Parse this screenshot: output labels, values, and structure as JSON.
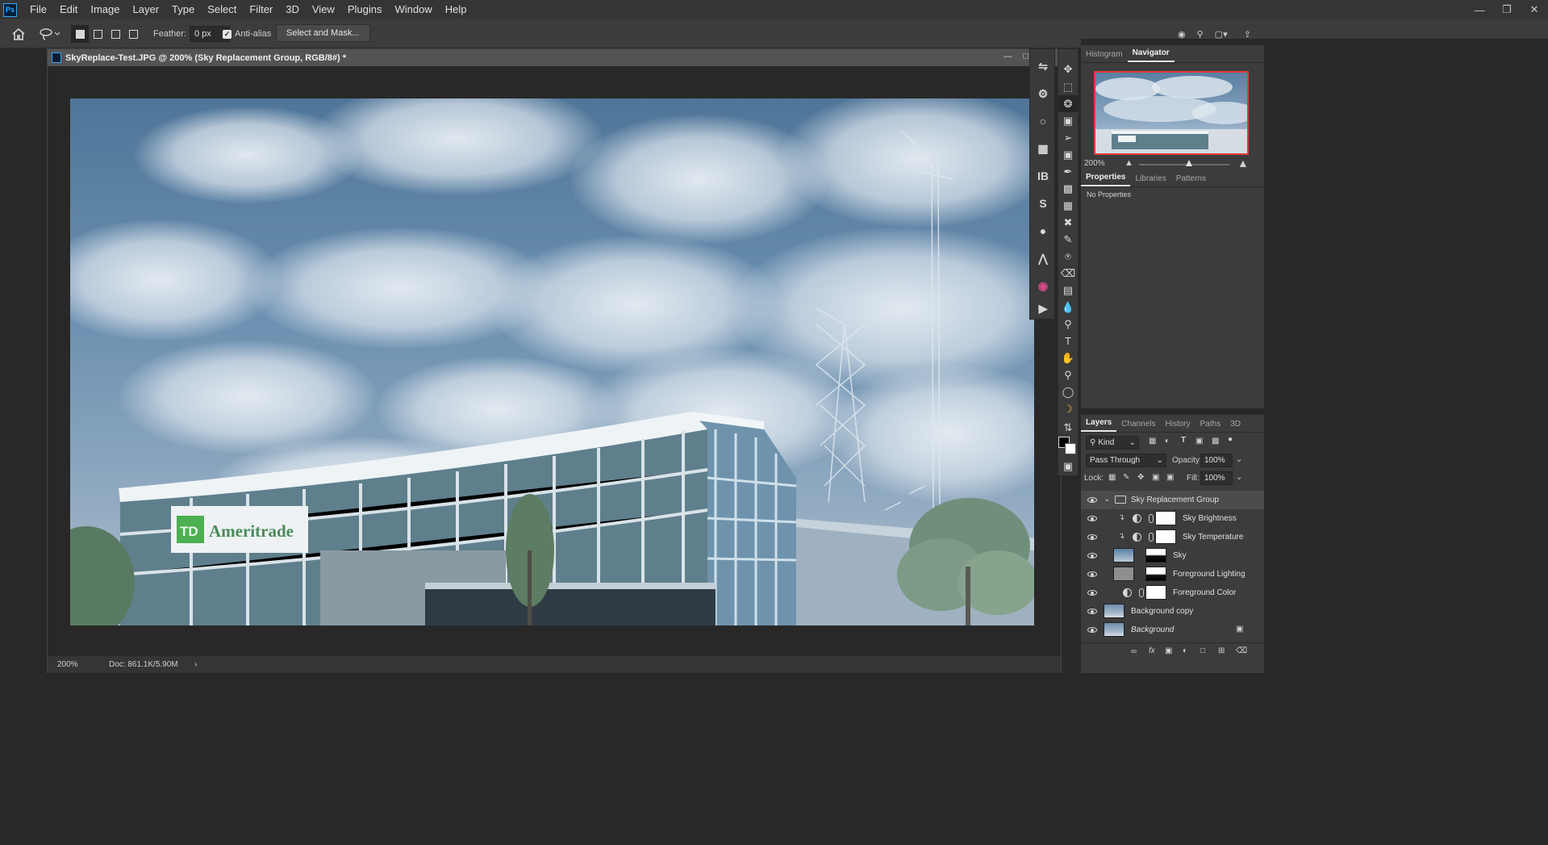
{
  "app": {
    "logo": "Ps",
    "menu": [
      "File",
      "Edit",
      "Image",
      "Layer",
      "Type",
      "Select",
      "Filter",
      "3D",
      "View",
      "Plugins",
      "Window",
      "Help"
    ],
    "window_controls": [
      "minimize-icon",
      "restore-icon",
      "close-icon"
    ]
  },
  "options": {
    "feather_label": "Feather:",
    "feather_value": "0 px",
    "antialias_label": "Anti-alias",
    "antialias_checked": true,
    "select_and_mask_label": "Select and Mask..."
  },
  "document": {
    "title": "SkyReplace-Test.JPG @ 200% (Sky Replacement Group, RGB/8#) *",
    "zoom": "200%",
    "doc_info": "Doc: 861.1K/5.90M"
  },
  "picture": {
    "sign_text": "TD Ameritrade"
  },
  "panels": {
    "top_tabs": [
      "Histogram",
      "Navigator"
    ],
    "top_active": "Navigator",
    "navigator_zoom": "200%",
    "props_tabs": [
      "Properties",
      "Libraries",
      "Patterns"
    ],
    "props_active": "Properties",
    "props_message": "No Properties",
    "layers_tabs": [
      "Layers",
      "Channels",
      "History",
      "Paths",
      "3D"
    ],
    "layers_active": "Layers",
    "filter_kind": "Kind",
    "blend_mode": "Pass Through",
    "opacity_label": "Opacity:",
    "opacity_value": "100%",
    "lock_label": "Lock:",
    "fill_label": "Fill:",
    "fill_value": "100%"
  },
  "layers": [
    {
      "name": "Sky Replacement Group",
      "kind": "group",
      "selected": true
    },
    {
      "name": "Sky Brightness",
      "kind": "adjustment"
    },
    {
      "name": "Sky Temperature",
      "kind": "adjustment"
    },
    {
      "name": "Sky",
      "kind": "image"
    },
    {
      "name": "Foreground Lighting",
      "kind": "image"
    },
    {
      "name": "Foreground Color",
      "kind": "adjustment"
    },
    {
      "name": "Background copy",
      "kind": "image"
    },
    {
      "name": "Background",
      "kind": "image",
      "locked": true
    }
  ],
  "colors": {
    "accent": "#31a8ff",
    "navigator_frame": "#e23a3a",
    "sign_green": "#4caf50"
  }
}
